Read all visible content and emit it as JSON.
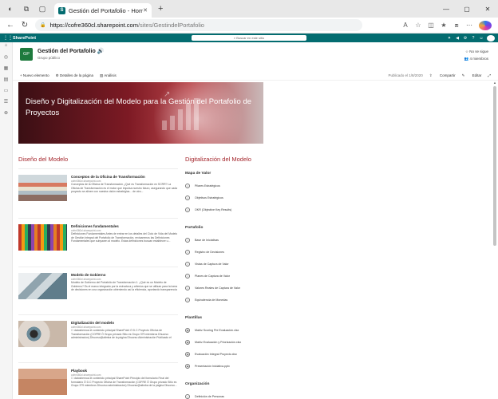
{
  "browser": {
    "tab_title": "Gestión del Portafolio - Home",
    "tab_icon_letter": "S",
    "url_host": "https://cofre360cl.sharepoint.com",
    "url_path": "/sites/GestindelPortafolio"
  },
  "suite": {
    "brand": "SharePoint",
    "search_placeholder": "Buscar en este sitio",
    "avatar_initials": "PE"
  },
  "site": {
    "logo_initials": "GP",
    "name": "Gestión del Portafolio",
    "subtitle": "Grupo público",
    "follow_label": "No se sigue",
    "members_label": "4 miembros"
  },
  "commands": {
    "new": "+ Nuevo elemento",
    "details": "Detalles de la página",
    "analytics": "Análisis",
    "published": "Publicado el 1/8/2020",
    "share": "Compartir",
    "edit": "Editar"
  },
  "hero": {
    "title": "Diseño y Digitalización del Modelo para la Gestión del Portafolio de Proyectos"
  },
  "left": {
    "title": "Diseño del Modelo",
    "articles": [
      {
        "title": "Conceptos de la Oficina de Transformación",
        "byline": "cofre360cl.sharepoint.com",
        "desc": "Conceptos de la Oficina de Transformación ¿Qué es Transformación en SCRR? La Oficina de Transformación es el motor que impulsa nuestro futuro, asegurando que cada proyecto se alinee con nuestra visión estratégica... de otro..."
      },
      {
        "title": "Definiciones fundamentales",
        "byline": "cofre360cl.sharepoint.com",
        "desc": "Definiciones Fundamentales Antes de entrar en los detalles del Ciclo de Vida del Modelo de Gestión Integral del Portafolio de Transformación, revisaremos las Definiciones Fundamentales que subyacen al modelo. Estas definiciones buscan establecer u..."
      },
      {
        "title": "Modelo de Gobierno",
        "byline": "cofre360cl.sharepoint.com",
        "desc": "Modelo de Gobierno del Portafolio de Transformación 1. ¿Qué es un Modelo de Gobierno? Es el marco integrado por la estructura y criterios que se utilizan para la toma de decisiones en una organización obteniendo así la eficiencia, aportando transparencia y fomentando la..."
      },
      {
        "title": "Digitalización del modelo",
        "byline": "cofre360cl.sharepoint.com",
        "desc": "☐ datoshemoa el contenido principal SharePoint Ó D.C Proyecto Oficina de Transformación (COFRE Ó Grupo privado Sitio es Grupo 379 miembros Dhuorso administracion) Dhuorso@alimba de la página Dhuorso Administración Publicado el 14/11/2024 Dhuorso..."
      },
      {
        "title": "Playbook",
        "byline": "cofre360cl.sharepoint.com",
        "desc": "☐ datoshemoa el contenido principal SharePoint Principio del formulario Final del formulario Ó D.C Proyecto Oficina de Transformación (COFRE Ó Grupo privado Sitio es Grupo 379 miembros Dhuorso administracion) Dhuorso@alimba de la página Dhuorso..."
      }
    ]
  },
  "right": {
    "title": "Digitalización del Modelo",
    "sections": [
      {
        "title": "Mapa de Valor",
        "links": [
          "Pilares Estratégicos",
          "Objetivos Estratégicos",
          "OKR (Objective Key Results)"
        ]
      },
      {
        "title": "Portafolio",
        "links": [
          "Base de Iniciativas",
          "Registro de Decisiones",
          "Vistas de Captura de Valor",
          "Planes de Captura de Valor",
          "Valores Reales de Captura de Valor",
          "Equivalencia de Monedas"
        ]
      },
      {
        "title": "Plantillas",
        "links": [
          "Matriz Scoring Pre Evaluación.xlsx",
          "Matriz Evaluación y Priorización.xlsx",
          "Evaluación Integral Proyecto.xlsx",
          "Presentación Iniciativa.pptx"
        ]
      },
      {
        "title": "Organización",
        "links": [
          "Definición de Personas"
        ]
      }
    ]
  }
}
